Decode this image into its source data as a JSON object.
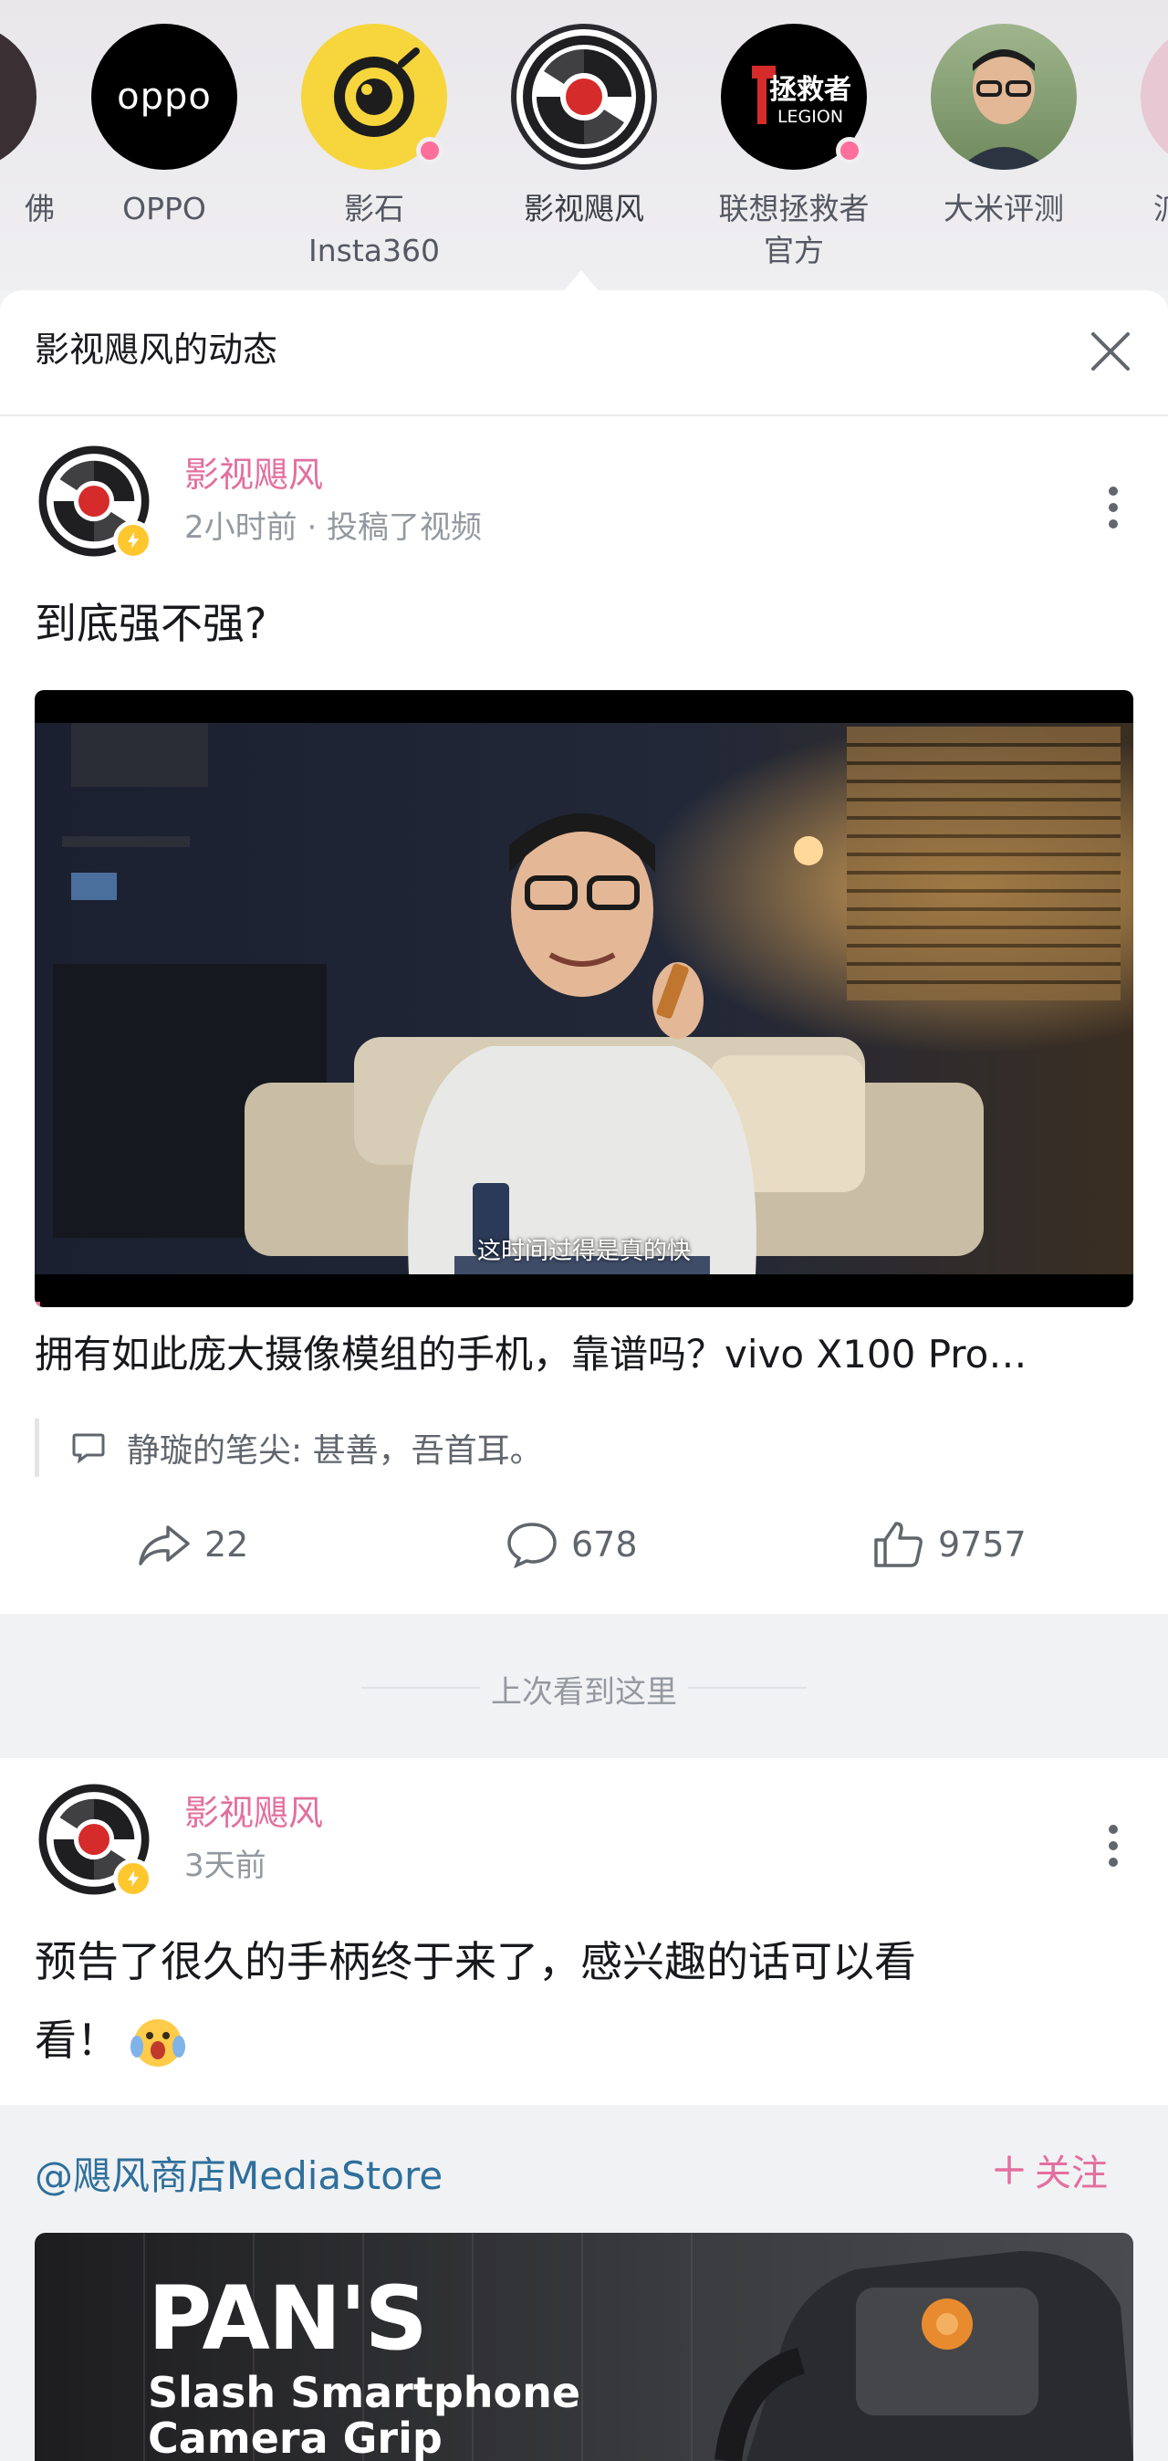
{
  "avatar_strip": {
    "items": [
      {
        "label": "佛",
        "name": "partial-left"
      },
      {
        "label": "OPPO",
        "brand_text": "oppo"
      },
      {
        "label": "影石\nInsta360",
        "has_dot": true
      },
      {
        "label": "影视飓风",
        "selected": true
      },
      {
        "label": "联想拯救者\n官方",
        "brand_text_top": "拯救者",
        "brand_text_bottom": "LEGION",
        "has_dot": true
      },
      {
        "label": "大米评测"
      },
      {
        "label": "派"
      }
    ]
  },
  "sheet": {
    "title": "影视飓风的动态"
  },
  "post1": {
    "author": "影视飓风",
    "meta": "2小时前 · 投稿了视频",
    "text": "到底强不强?",
    "video_subtitle": "这时间过得是真的快",
    "video_title": "拥有如此庞大摄像模组的手机，靠谱吗？vivo X100 Pro…",
    "comment_preview": "静璇的笔尖: 甚善，吾首耳。",
    "shares": "22",
    "comments": "678",
    "likes": "9757"
  },
  "divider": {
    "text": "上次看到这里"
  },
  "post2": {
    "author": "影视飓风",
    "meta": "3天前",
    "text_line1": "预告了很久的手柄终于来了，感兴趣的话可以看",
    "text_line2": "看！",
    "shared_user": "@飓风商店MediaStore",
    "follow_label": "关注",
    "banner_title": "PAN'S",
    "banner_subtitle_1": "Slash Smartphone",
    "banner_subtitle_2": "Camera Grip"
  },
  "colors": {
    "accent_pink": "#e36f9e",
    "link_blue": "#2e6f9c",
    "verified_yellow": "#ffc72e",
    "brand_red": "#d62b2b"
  }
}
